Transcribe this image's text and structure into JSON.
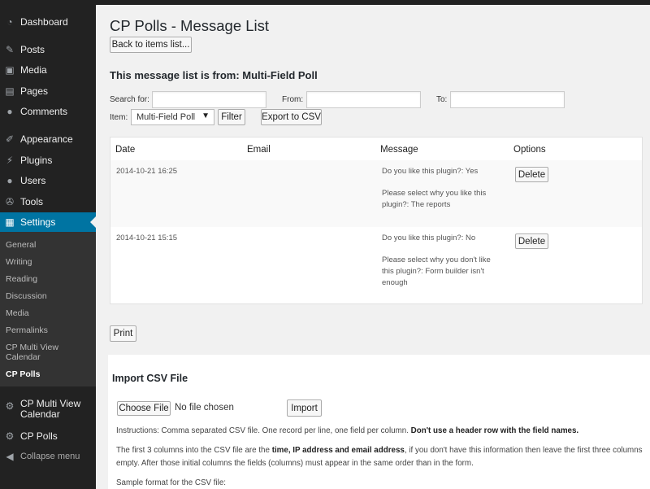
{
  "sidebar": {
    "menu": [
      {
        "label": "Dashboard",
        "icon": "dashboard-icon"
      },
      {
        "label": "Posts",
        "icon": "pin-icon"
      },
      {
        "label": "Media",
        "icon": "media-icon"
      },
      {
        "label": "Pages",
        "icon": "pages-icon"
      },
      {
        "label": "Comments",
        "icon": "comment-icon"
      },
      {
        "label": "Appearance",
        "icon": "brush-icon"
      },
      {
        "label": "Plugins",
        "icon": "plug-icon"
      },
      {
        "label": "Users",
        "icon": "user-icon"
      },
      {
        "label": "Tools",
        "icon": "wrench-icon"
      },
      {
        "label": "Settings",
        "icon": "settings-icon"
      }
    ],
    "submenu": [
      "General",
      "Writing",
      "Reading",
      "Discussion",
      "Media",
      "Permalinks",
      "CP Multi View Calendar",
      "CP Polls"
    ],
    "lower_menu": [
      {
        "label": "CP Multi View Calendar",
        "icon": "gear-icon"
      },
      {
        "label": "CP Polls",
        "icon": "gear-icon"
      }
    ],
    "collapse_label": "Collapse menu"
  },
  "page": {
    "title": "CP Polls - Message List",
    "back_button": "Back to items list...",
    "subtitle": "This message list is from: Multi-Field Poll"
  },
  "filters": {
    "search_label": "Search for:",
    "from_label": "From:",
    "to_label": "To:",
    "item_label": "Item:",
    "item_selected": "Multi-Field Poll",
    "filter_button": "Filter",
    "export_button": "Export to CSV"
  },
  "table": {
    "headers": [
      "Date",
      "Email",
      "Message",
      "Options"
    ],
    "rows": [
      {
        "date": "2014-10-21 16:25",
        "email": "",
        "message_1": "Do you like this plugin?: Yes",
        "message_2": "Please select why you like this plugin?: The reports",
        "action": "Delete"
      },
      {
        "date": "2014-10-21 15:15",
        "email": "",
        "message_1": "Do you like this plugin?: No",
        "message_2": "Please select why you don't like this plugin?: Form builder isn't enough",
        "action": "Delete"
      }
    ]
  },
  "print_button": "Print",
  "import": {
    "title": "Import CSV File",
    "choose_button": "Choose File",
    "no_file": "No file chosen",
    "import_button": "Import",
    "instructions_prefix": "Instructions: Comma separated CSV file. One record per line, one field per column.",
    "instructions_bold": "Don't use a header row with the field names.",
    "columns_part1": "The first 3 columns into the CSV file are the",
    "columns_bold": "time, IP address and email address",
    "columns_part2": ", if you don't have this information then leave the first three columns empty. After those initial columns the fields (columns) must appear in the same order than in the form.",
    "sample_label": "Sample format for the CSV file:"
  },
  "colors": {
    "sidebar_bg": "#222222",
    "submenu_bg": "#333333",
    "accent": "#0074a2",
    "page_bg": "#f1f1f1"
  }
}
